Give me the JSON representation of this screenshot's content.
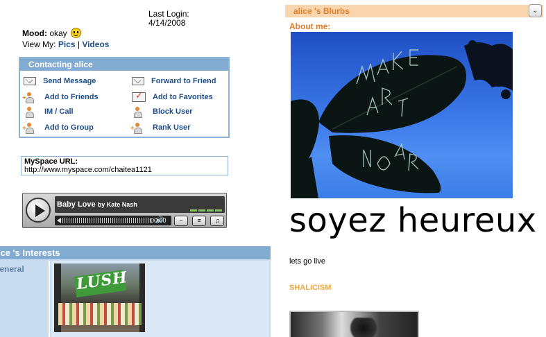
{
  "profile": {
    "last_login_label": "Last Login:",
    "last_login_date": "4/14/2008",
    "mood_label": "Mood:",
    "mood_value": "okay",
    "view_my_label": "View My:",
    "view_pics": "Pics",
    "view_separator": "|",
    "view_videos": "Videos"
  },
  "contacting": {
    "title": "Contacting alice",
    "items": [
      {
        "label": "Send Message",
        "icon": "envelope-icon"
      },
      {
        "label": "Forward to Friend",
        "icon": "forward-envelope-icon"
      },
      {
        "label": "Add to Friends",
        "icon": "add-friend-icon"
      },
      {
        "label": "Add to Favorites",
        "icon": "favorites-check-icon"
      },
      {
        "label": "IM / Call",
        "icon": "im-call-icon"
      },
      {
        "label": "Block User",
        "icon": "block-user-icon"
      },
      {
        "label": "Add to Group",
        "icon": "add-group-icon"
      },
      {
        "label": "Rank User",
        "icon": "rank-user-icon"
      }
    ]
  },
  "myspace_url": {
    "label": "MySpace URL:",
    "value": "http://www.myspace.com/chaitea1121"
  },
  "player": {
    "song": "Baby Love",
    "by": "by Kate Nash",
    "time": "00:00"
  },
  "interests": {
    "title": "alice 's Interests",
    "category": "General",
    "image_caption": "LUSH"
  },
  "blurbs": {
    "title": "alice 's Blurbs",
    "about_me_label": "About me:",
    "big_text": "soyez heureux",
    "small_text": "lets go live",
    "heading2": "SHALICISM"
  },
  "colors": {
    "myspace_blue": "#82abd1",
    "link_blue": "#1d4d8a",
    "blurb_orange": "#e07f2c",
    "blurb_bar": "#f9d5ae"
  }
}
